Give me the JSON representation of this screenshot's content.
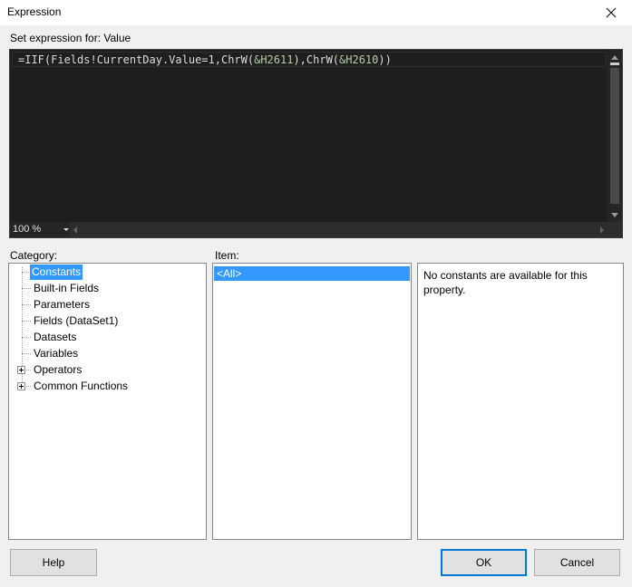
{
  "window": {
    "title": "Expression"
  },
  "editor": {
    "set_label": "Set expression for: Value",
    "code_parts": [
      "=IIF(Fields!CurrentDay.Value=1,ChrW(",
      "&H2611",
      "),ChrW(",
      "&H2610",
      "))"
    ],
    "zoom": "100 %"
  },
  "category": {
    "label": "Category:",
    "items": [
      {
        "label": "Constants"
      },
      {
        "label": "Built-in Fields"
      },
      {
        "label": "Parameters"
      },
      {
        "label": "Fields (DataSet1)"
      },
      {
        "label": "Datasets"
      },
      {
        "label": "Variables"
      },
      {
        "label": "Operators"
      },
      {
        "label": "Common Functions"
      }
    ]
  },
  "item": {
    "label": "Item:",
    "items": [
      {
        "label": "<All>"
      }
    ]
  },
  "description": {
    "text": "No constants are available for this property."
  },
  "buttons": {
    "help": "Help",
    "ok": "OK",
    "cancel": "Cancel"
  },
  "colors": {
    "selection": "#3399ff",
    "editor_bg": "#1e1e1e",
    "default_button_border": "#0078d7"
  }
}
